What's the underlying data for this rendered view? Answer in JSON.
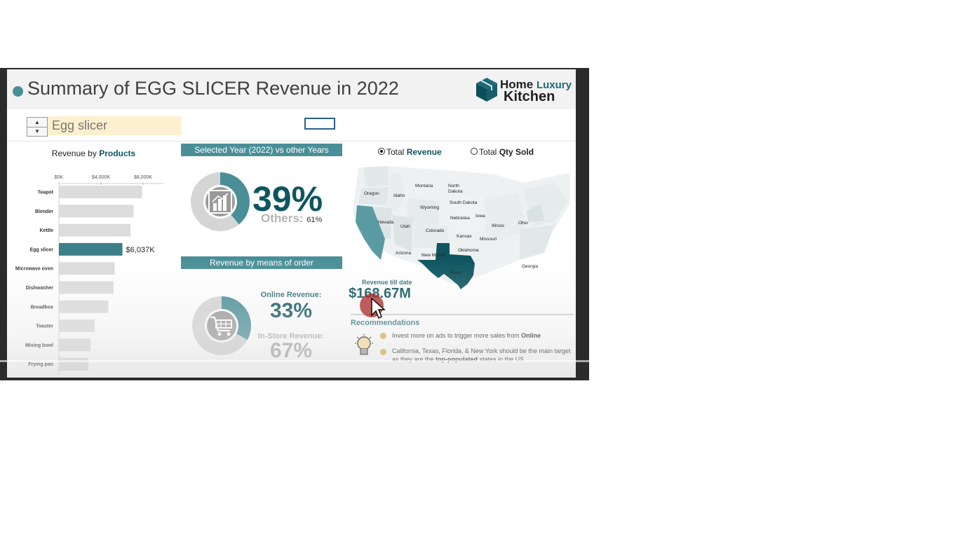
{
  "header": {
    "title": "Summary of EGG SLICER Revenue in 2022",
    "logo_home": "Home",
    "logo_luxury": "Luxury",
    "logo_kitchen": "Kitchen"
  },
  "controls": {
    "spin_up": "▲",
    "spin_down": "▼",
    "selected_product": "Egg slicer"
  },
  "chart_data": [
    {
      "type": "bar",
      "title_prefix": "Revenue by",
      "title_strong": "Products",
      "axis_ticks": [
        "$0K",
        "$4,000K",
        "$8,000K"
      ],
      "xlim": [
        0,
        10000
      ],
      "categories": [
        "Teapot",
        "Blender",
        "Kettle",
        "Egg slicer",
        "Microwave oven",
        "Dishwasher",
        "Breadbox",
        "Toaster",
        "Mixing bowl",
        "Frying pan"
      ],
      "values": [
        7900,
        7100,
        6800,
        6037,
        5300,
        5200,
        4700,
        3400,
        3000,
        2800
      ],
      "highlight": "Egg slicer",
      "highlight_label": "$6,037K",
      "highlight_color": "#3d7f88",
      "bar_color": "#dcdcdc"
    },
    {
      "type": "pie",
      "title": "Selected Year (2022) vs other Years",
      "slices": [
        {
          "label": "2022",
          "value": 39
        },
        {
          "label": "Others",
          "value": 61
        }
      ],
      "big_value": "39%",
      "others_label": "Others:",
      "others_value": "61%"
    },
    {
      "type": "pie",
      "title": "Revenue by means of order",
      "slices": [
        {
          "label": "Online",
          "value": 33
        },
        {
          "label": "In-Store",
          "value": 67
        }
      ],
      "online_label": "Online Revenue:",
      "online_value": "33%",
      "store_label": "In-Store Revenue:",
      "store_value": "67%"
    }
  ],
  "map": {
    "radio_revenue_prefix": "Total",
    "radio_revenue_strong": "Revenue",
    "radio_qty_prefix": "Total",
    "radio_qty_strong": "Qty Sold",
    "revenue_label": "Revenue till date",
    "revenue_value": "$168.67M",
    "states": [
      "Oregon",
      "Idaho",
      "Montana",
      "North Dakota",
      "Wyoming",
      "South Dakota",
      "Nevada",
      "Utah",
      "Colorado",
      "Nebraska",
      "Iowa",
      "Illinois",
      "Ohio",
      "Kansas",
      "Missouri",
      "Arizona",
      "New Mexico",
      "Oklahoma",
      "Texas",
      "Georgia"
    ],
    "highlight_color": "#0d5560",
    "mid_color": "#5a9aa3"
  },
  "recommendations": {
    "title": "Recommendations",
    "item1_text": "Invest more on ads to trigger more sales from",
    "item1_strong": "Online",
    "item2_text_a": "California, Texas, Florida, & New York should be the main target as they are the",
    "item2_strong": "top-populated",
    "item2_text_b": "states in the US"
  }
}
